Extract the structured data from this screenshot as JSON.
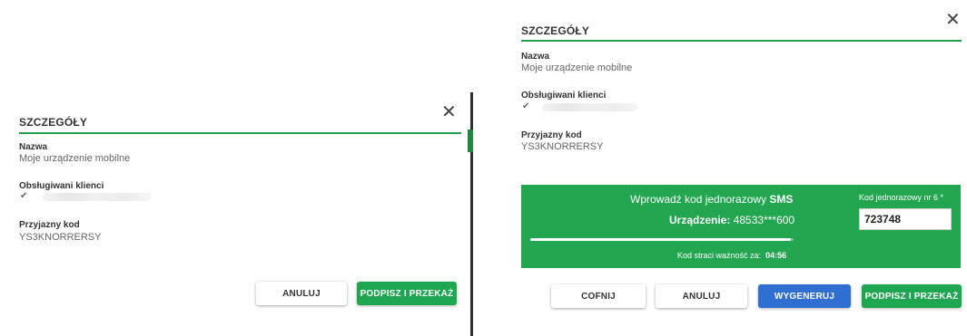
{
  "colors": {
    "brand_green": "#22a650",
    "primary_blue": "#2f6fd1"
  },
  "left_dialog": {
    "title": "SZCZEGÓŁY",
    "name_label": "Nazwa",
    "name_value": "Moje urządzenie mobilne",
    "clients_label": "Obsługiwani klienci",
    "friendly_label": "Przyjazny kod",
    "friendly_value": "YS3KNORRERSY",
    "cancel_label": "ANULUJ",
    "sign_label": "PODPISZ I PRZEKAŻ"
  },
  "right_dialog": {
    "title": "SZCZEGÓŁY",
    "name_label": "Nazwa",
    "name_value": "Moje urządzenie mobilne",
    "clients_label": "Obsługiwani klienci",
    "friendly_label": "Przyjazny kod",
    "friendly_value": "YS3KNORRERSY",
    "sms": {
      "prompt_prefix": "Wprowadź kod jednorazowy ",
      "prompt_strong": "SMS",
      "device_label": "Urządzenie:",
      "device_value": "48533***600",
      "expiry_label": "Kod straci ważność za:",
      "expiry_value": "04:56",
      "progress": 0.99,
      "code_label": "Kod jednorazowy nr 6 *",
      "code_value": "723748"
    },
    "back_label": "COFNIJ",
    "cancel_label": "ANULUJ",
    "generate_label": "WYGENERUJ",
    "sign_label": "PODPISZ I PRZEKAŻ"
  }
}
